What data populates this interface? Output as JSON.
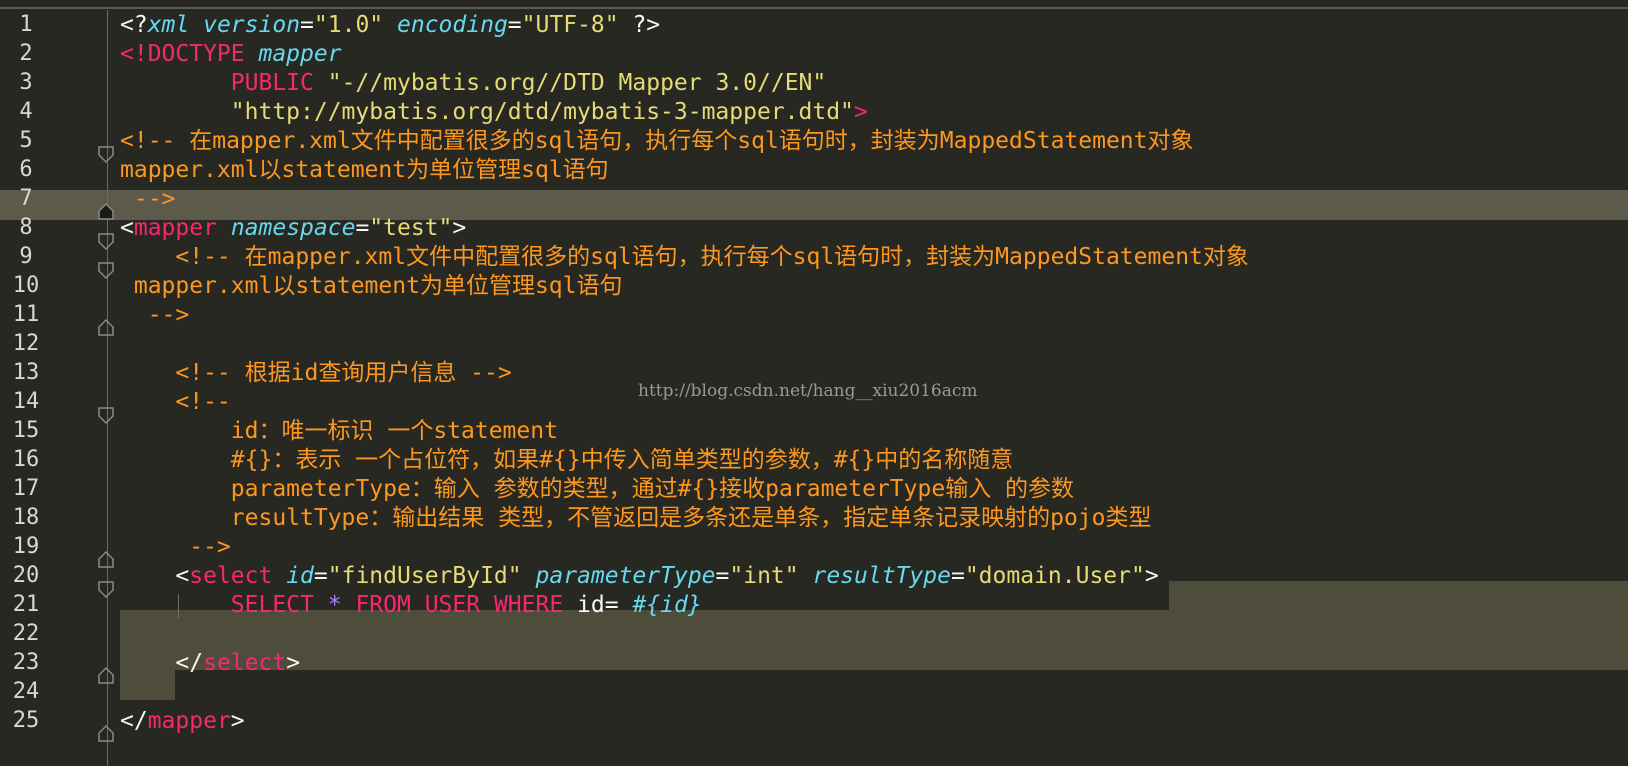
{
  "editor": {
    "watermark": "http://blog.csdn.net/hang__xiu2016acm",
    "line_numbers": [
      "1",
      "2",
      "3",
      "4",
      "5",
      "6",
      "7",
      "8",
      "9",
      "10",
      "11",
      "12",
      "13",
      "14",
      "15",
      "16",
      "17",
      "18",
      "19",
      "20",
      "21",
      "22",
      "23",
      "24",
      "25"
    ],
    "current_line": "7",
    "lines": {
      "l1": {
        "a": "<?",
        "b": "xml",
        "c": " ",
        "d": "version",
        "e": "=",
        "f": "\"1.0\"",
        "g": " ",
        "h": "encoding",
        "i": "=",
        "j": "\"UTF-8\"",
        "k": " ?>"
      },
      "l2": {
        "a": "<!DOCTYPE",
        "b": " ",
        "c": "mapper"
      },
      "l3": {
        "a": "        PUBLIC",
        "b": " ",
        "c": "\"-//mybatis.org//DTD Mapper 3.0//EN\""
      },
      "l4": {
        "a": "        \"http://mybatis.org/dtd/mybatis-3-mapper.dtd\"",
        "b": ">"
      },
      "l5": "<!-- 在mapper.xml文件中配置很多的sql语句，执行每个sql语句时，封装为MappedStatement对象",
      "l6": "mapper.xml以statement为单位管理sql语句",
      "l7": " -->",
      "l8": {
        "a": "<",
        "b": "mapper",
        "c": " ",
        "d": "namespace",
        "e": "=",
        "f": "\"test\"",
        "g": ">"
      },
      "l9": "    <!-- 在mapper.xml文件中配置很多的sql语句，执行每个sql语句时，封装为MappedStatement对象",
      "l10": " mapper.xml以statement为单位管理sql语句",
      "l11": "  -->",
      "l12": "",
      "l13": "    <!-- 根据id查询用户信息 -->",
      "l14": "    <!--",
      "l15": "        id：唯一标识 一个statement",
      "l16": "        #{}：表示 一个占位符，如果#{}中传入简单类型的参数，#{}中的名称随意",
      "l17": "        parameterType：输入 参数的类型，通过#{}接收parameterType输入 的参数",
      "l18": "        resultType：输出结果 类型，不管返回是多条还是单条，指定单条记录映射的pojo类型",
      "l19": "     -->",
      "l20": {
        "a": "    <",
        "b": "select",
        "c": " ",
        "d": "id",
        "e": "=",
        "f": "\"findUserById\"",
        "g": " ",
        "h": "parameterType",
        "i": "=",
        "j": "\"int\"",
        "k": " ",
        "l": "resultType",
        "m": "=",
        "n": "\"domain.User\"",
        "o": ">"
      },
      "l21": {
        "a": "        ",
        "b": "SELECT",
        "c": " ",
        "d": "*",
        "e": " ",
        "f": "FROM",
        "g": " ",
        "h": "USER",
        "i": " ",
        "j": "WHERE",
        "k": " id= ",
        "l": "#{id}"
      },
      "l22": "",
      "l23": {
        "a": "    </",
        "b": "select",
        "c": ">"
      },
      "l24": "",
      "l25": {
        "a": "</",
        "b": "mapper",
        "c": ">"
      }
    }
  },
  "colors": {
    "background": "#272822",
    "tag": "#f92672",
    "attribute": "#66d9ef",
    "string": "#e6db74",
    "comment": "#fd971f",
    "selection": "#4e4c3a",
    "current_line": "#5b5a4b"
  }
}
